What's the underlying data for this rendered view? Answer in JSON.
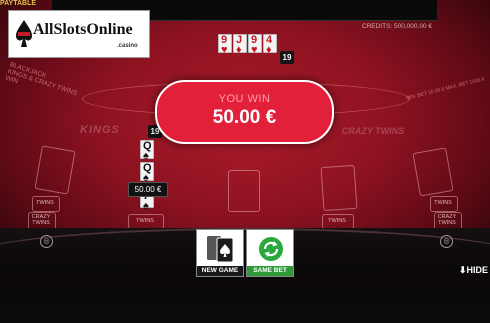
{
  "header": {
    "paytable": "PAYTABLE",
    "credits": "CREDITS: 500,000.00 €"
  },
  "logo": {
    "text": "AllSlotsOnline",
    "sub": ".casino"
  },
  "table": {
    "left_arc_text": [
      "BLACKJACK",
      "KINGS & CRAZY TWINS",
      "WIN"
    ],
    "right_arc_text": "MIN. BET 10.00 €   MAX. BET 1000 €",
    "left_emblem": "KINGS",
    "right_emblem": "CRAZY TWINS",
    "spot_labels": {
      "twins": "TWINS",
      "crazy_twins": "CRAZY TWINS"
    }
  },
  "dealer": {
    "cards": [
      {
        "rank": "9",
        "suit": "♥",
        "color": "red"
      },
      {
        "rank": "J",
        "suit": "♦",
        "color": "red"
      },
      {
        "rank": "9",
        "suit": "♥",
        "color": "red"
      },
      {
        "rank": "4",
        "suit": "♦",
        "color": "red"
      }
    ],
    "total": "19"
  },
  "player": {
    "cards": [
      {
        "rank": "Q",
        "suit": "♠",
        "color": "black"
      },
      {
        "rank": "Q",
        "suit": "♠",
        "color": "black"
      },
      {
        "rank": "7",
        "suit": "♠",
        "color": "black"
      }
    ],
    "total": "19",
    "bet": "50.00 €"
  },
  "result": {
    "label": "YOU WIN",
    "amount": "50.00 €"
  },
  "actions": {
    "new_game": "NEW GAME",
    "same_bet": "SAME BET"
  },
  "hide": "HIDE",
  "colors": {
    "felt": "#8c1220",
    "win_pill": "#e3203a",
    "new_game_bar": "#1a1a1a",
    "same_bet_bar": "#2f9a3a",
    "same_bet_icon": "#2aa83c"
  }
}
